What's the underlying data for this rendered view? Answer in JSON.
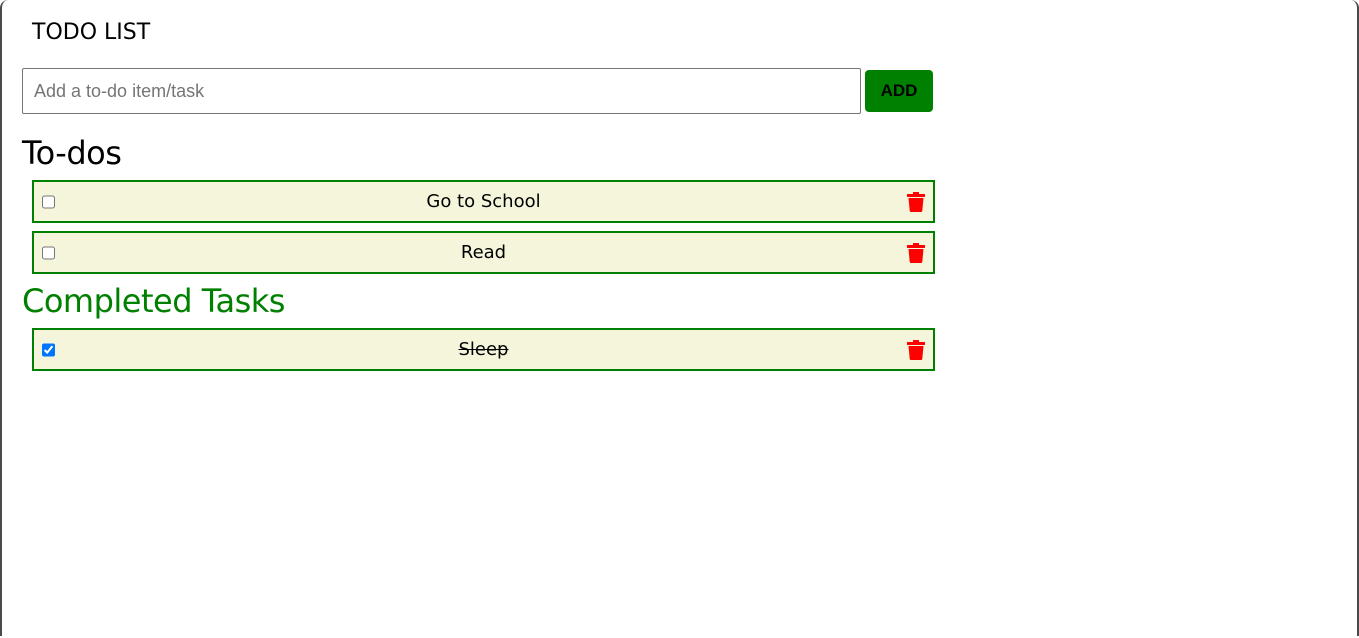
{
  "app": {
    "title": "TODO LIST"
  },
  "add_form": {
    "input_value": "",
    "placeholder": "Add a to-do item/task",
    "add_label": "ADD"
  },
  "todos": {
    "heading": "To-dos",
    "items": [
      {
        "text": "Go to School",
        "checked": false,
        "delete_icon": "trash-icon"
      },
      {
        "text": "Read",
        "checked": false,
        "delete_icon": "trash-icon"
      }
    ]
  },
  "completed": {
    "heading": "Completed Tasks",
    "items": [
      {
        "text": "Sleep",
        "checked": true,
        "delete_icon": "trash-icon"
      }
    ]
  },
  "colors": {
    "accent_green": "#008000",
    "item_background": "#f5f5dc",
    "delete_red": "#ff0000"
  }
}
